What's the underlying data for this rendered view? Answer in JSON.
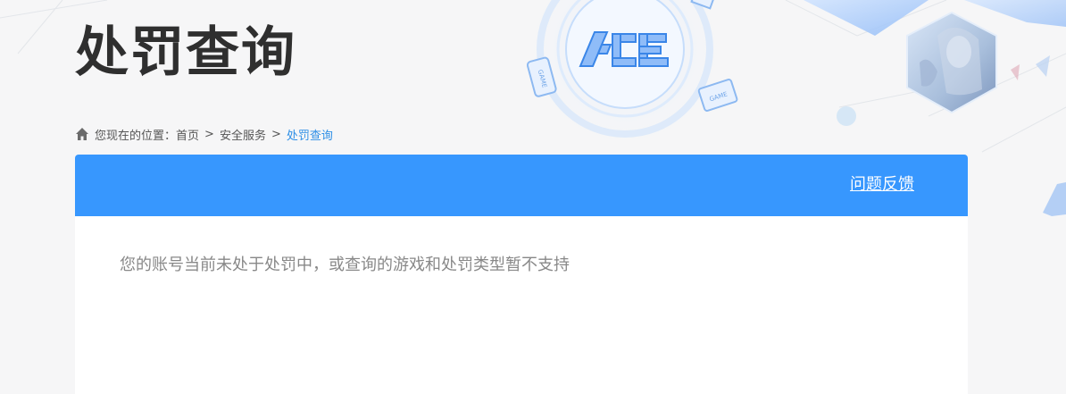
{
  "header": {
    "title": "处罚查询",
    "logo_text": "ACE",
    "badge_text": "GAME"
  },
  "breadcrumb": {
    "prefix": "您现在的位置：",
    "items": [
      "首页",
      "安全服务"
    ],
    "separator": ">",
    "current": "处罚查询"
  },
  "panel": {
    "feedback_label": "问题反馈",
    "message": "您的账号当前未处于处罚中，或查询的游戏和处罚类型暂不支持"
  },
  "colors": {
    "accent": "#3797fe",
    "breadcrumb_current": "#2e8fe6",
    "title": "#2f2f2f",
    "message": "#888888"
  },
  "icons": {
    "home": "home-icon",
    "logo": "ace-logo",
    "avatar": "character-avatar"
  }
}
